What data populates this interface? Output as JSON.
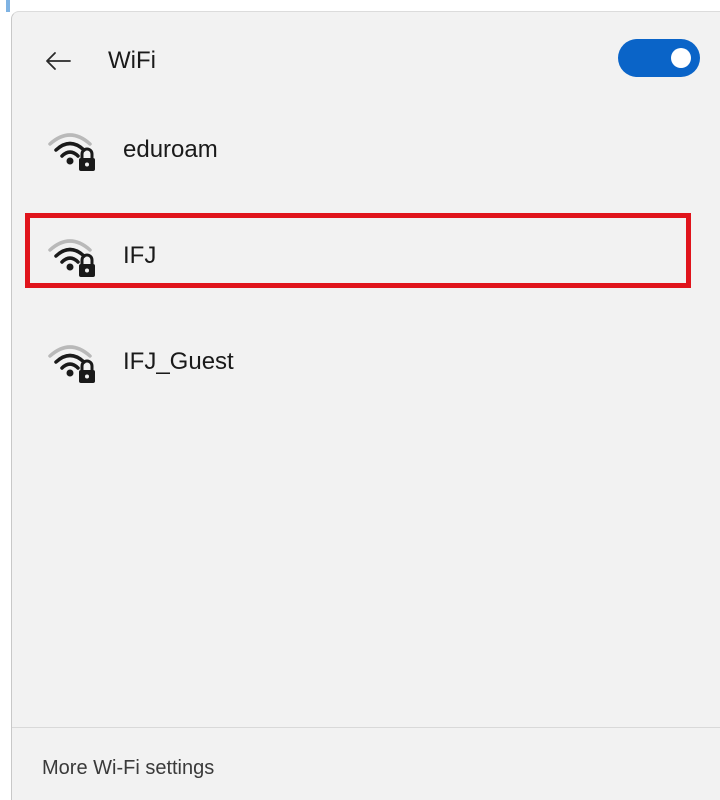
{
  "header": {
    "back_icon": "arrow-left-icon",
    "title": "WiFi",
    "toggle_state": "on",
    "toggle_color": "#0a64c8"
  },
  "networks": [
    {
      "name": "eduroam",
      "icon": "wifi-secured-icon",
      "highlighted": false
    },
    {
      "name": "IFJ",
      "icon": "wifi-secured-icon",
      "highlighted": true
    },
    {
      "name": "IFJ_Guest",
      "icon": "wifi-secured-icon",
      "highlighted": false
    }
  ],
  "highlight_color": "#e0141c",
  "footer": {
    "more_settings": "More Wi-Fi settings"
  }
}
